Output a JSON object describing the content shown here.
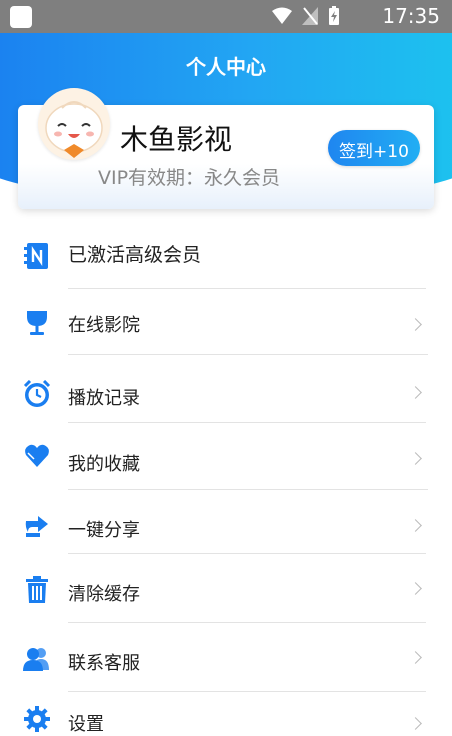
{
  "status_bar": {
    "time": "17:35"
  },
  "header": {
    "title": "个人中心"
  },
  "profile": {
    "username": "木鱼影视",
    "vip_text": "VIP有效期：永久会员",
    "checkin_label": "签到+10"
  },
  "menu": [
    {
      "label": "已激活高级会员",
      "icon": "notebook-icon"
    },
    {
      "label": "在线影院",
      "icon": "cup-icon"
    },
    {
      "label": "播放记录",
      "icon": "alarm-clock-icon"
    },
    {
      "label": "我的收藏",
      "icon": "heart-icon"
    },
    {
      "label": "一键分享",
      "icon": "share-icon"
    },
    {
      "label": "清除缓存",
      "icon": "trash-icon"
    },
    {
      "label": "联系客服",
      "icon": "contacts-icon"
    },
    {
      "label": "设置",
      "icon": "gear-icon"
    }
  ],
  "colors": {
    "primary": "#1a7ef0",
    "accent": "#22aef3"
  }
}
